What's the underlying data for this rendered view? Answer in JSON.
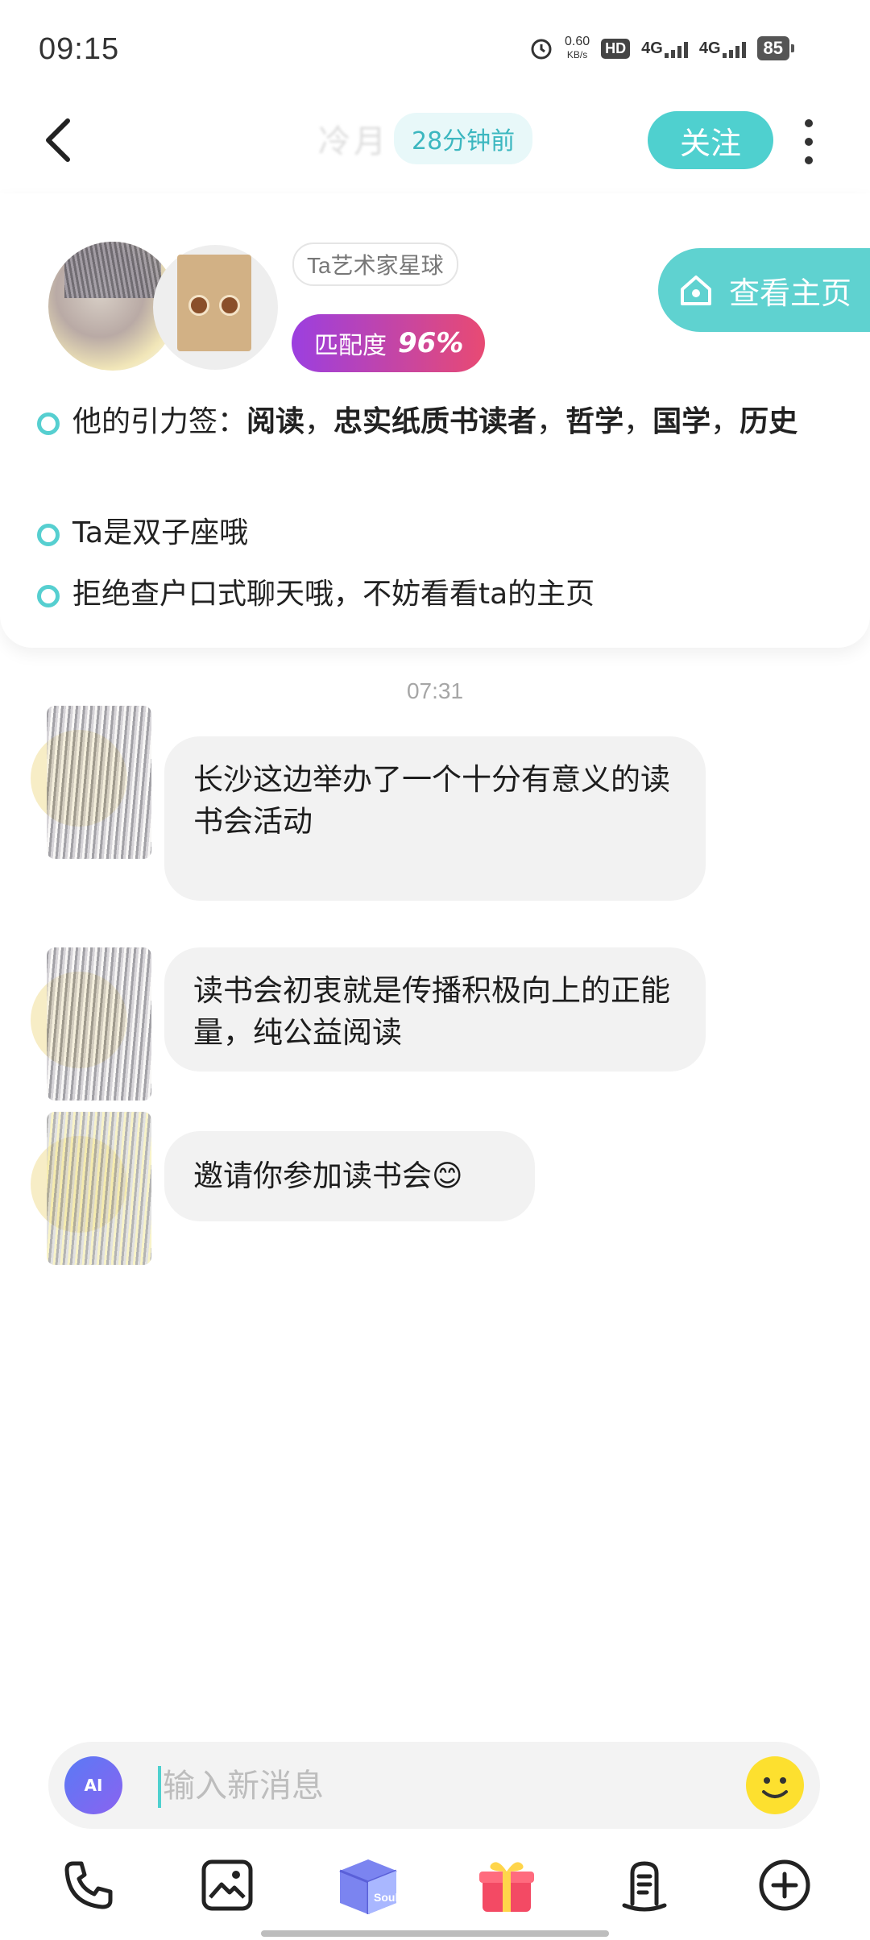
{
  "status_bar": {
    "time": "09:15",
    "net_speed": "0.60",
    "net_unit": "KB/s",
    "hd": "HD",
    "sim1": "4G",
    "sim2": "4G",
    "battery": "85"
  },
  "header": {
    "name": "冷月",
    "last_active": "28分钟前",
    "follow_label": "关注"
  },
  "profile": {
    "planet": "Ta艺术家星球",
    "match_label": "匹配度",
    "match_value": "96%",
    "homepage_label": "查看主页",
    "tags_prefix": "他的引力签：",
    "tags": [
      "阅读",
      "忠实纸质书读者",
      "哲学",
      "国学",
      "历史"
    ],
    "tag_separator": "，",
    "zodiac_line": "Ta是双子座哦",
    "tip_line": "拒绝查户口式聊天哦，不妨看看ta的主页"
  },
  "chat": {
    "timestamp": "07:31",
    "messages": [
      {
        "text": "长沙这边举办了一个十分有意义的读书会活动"
      },
      {
        "text": "读书会初衷就是传播积极向上的正能量，纯公益阅读"
      },
      {
        "text": "邀请你参加读书会😊"
      }
    ]
  },
  "input": {
    "ai_label": "AI",
    "placeholder": "输入新消息"
  },
  "toolbar": {
    "soul_label": "Soul"
  },
  "colors": {
    "accent": "#4fd0cf",
    "bubble": "#f2f2f2",
    "match_start": "#9b3fe0",
    "match_end": "#e84a73"
  }
}
